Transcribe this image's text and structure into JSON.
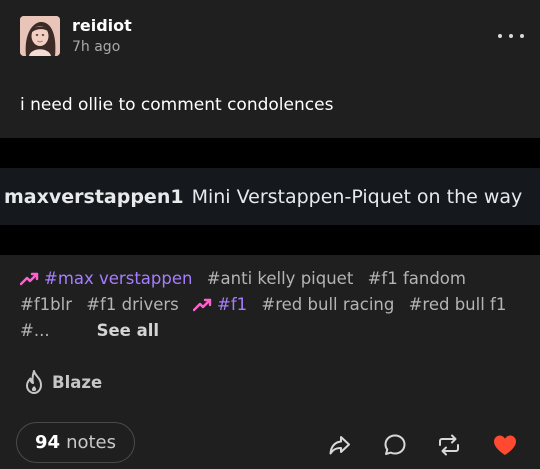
{
  "post": {
    "author": "reidiot",
    "time_ago": "7h ago",
    "text": "i need ollie to comment condolences",
    "image": {
      "handle": "maxverstappen1",
      "caption": "Mini Verstappen-Piquet on the way"
    }
  },
  "tags": [
    {
      "label": "#max verstappen",
      "featured": true
    },
    {
      "label": "#anti kelly piquet",
      "featured": false
    },
    {
      "label": "#f1 fandom",
      "featured": false
    },
    {
      "label": "#f1blr",
      "featured": false
    },
    {
      "label": "#f1 drivers",
      "featured": false
    },
    {
      "label": "#f1",
      "featured": true
    },
    {
      "label": "#red bull racing",
      "featured": false
    },
    {
      "label": "#red bull f1",
      "featured": false
    },
    {
      "label": "#...",
      "featured": false
    }
  ],
  "see_all_label": "See all",
  "blaze_label": "Blaze",
  "notes": {
    "count": "94",
    "label": "notes"
  },
  "icons": {
    "more": "more-icon",
    "trending": "trending-up-icon",
    "blaze": "flame-icon",
    "share": "share-icon",
    "reply": "reply-icon",
    "reblog": "reblog-icon",
    "like": "heart-icon"
  },
  "colors": {
    "background": "#1f1f1f",
    "featured_tag": "#a77dff",
    "trending_icon": "#ff62ce",
    "like": "#ff4930"
  }
}
